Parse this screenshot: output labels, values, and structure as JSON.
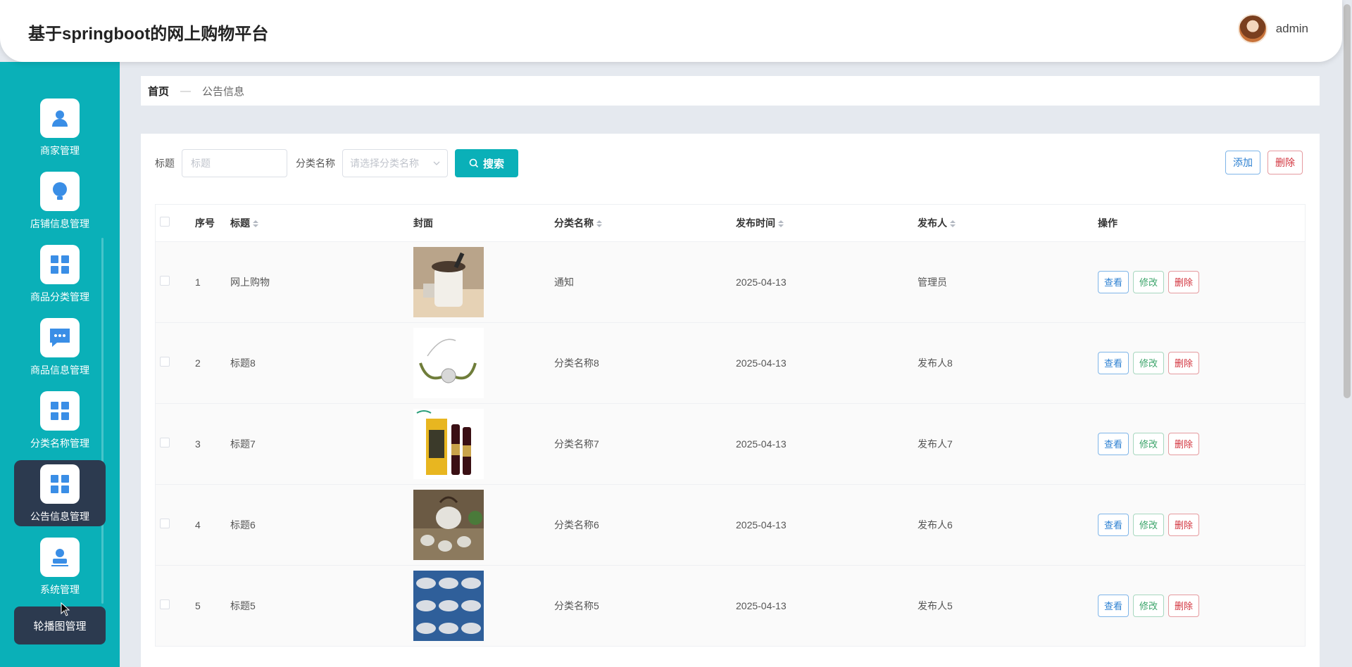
{
  "header": {
    "title": "基于springboot的网上购物平台",
    "username": "admin"
  },
  "sidebar": {
    "items": [
      {
        "label": "商家管理",
        "icon": "user-icon"
      },
      {
        "label": "店铺信息管理",
        "icon": "bulb-icon"
      },
      {
        "label": "商品分类管理",
        "icon": "grid-icon"
      },
      {
        "label": "商品信息管理",
        "icon": "message-icon"
      },
      {
        "label": "分类名称管理",
        "icon": "grid-icon"
      },
      {
        "label": "公告信息管理",
        "icon": "grid-icon",
        "active": true
      },
      {
        "label": "系统管理",
        "icon": "stamp-icon"
      }
    ],
    "tooltip": "轮播图管理"
  },
  "breadcrumb": {
    "home": "首页",
    "separator": "—",
    "current": "公告信息"
  },
  "toolbar": {
    "title_label": "标题",
    "title_placeholder": "标题",
    "category_label": "分类名称",
    "category_placeholder": "请选择分类名称",
    "search_label": "搜索",
    "add_label": "添加",
    "delete_label": "删除"
  },
  "table": {
    "headers": {
      "index": "序号",
      "title": "标题",
      "cover": "封面",
      "category": "分类名称",
      "date": "发布时间",
      "publisher": "发布人",
      "actions": "操作"
    },
    "actions": {
      "view": "查看",
      "edit": "修改",
      "delete": "删除"
    },
    "rows": [
      {
        "index": "1",
        "title": "网上购物",
        "category": "通知",
        "date": "2025-04-13",
        "publisher": "管理员",
        "cover": "blender"
      },
      {
        "index": "2",
        "title": "标题8",
        "category": "分类名称8",
        "date": "2025-04-13",
        "publisher": "发布人8",
        "cover": "bracelet"
      },
      {
        "index": "3",
        "title": "标题7",
        "category": "分类名称7",
        "date": "2025-04-13",
        "publisher": "发布人7",
        "cover": "wine"
      },
      {
        "index": "4",
        "title": "标题6",
        "category": "分类名称6",
        "date": "2025-04-13",
        "publisher": "发布人6",
        "cover": "teaset"
      },
      {
        "index": "5",
        "title": "标题5",
        "category": "分类名称5",
        "date": "2025-04-13",
        "publisher": "发布人5",
        "cover": "fish"
      }
    ]
  },
  "colors": {
    "accent": "#0ab0b8",
    "active_nav": "#2c3a4f",
    "view_btn": "#2b7fd1",
    "edit_btn": "#3ba46a",
    "delete_btn": "#d2333d"
  }
}
